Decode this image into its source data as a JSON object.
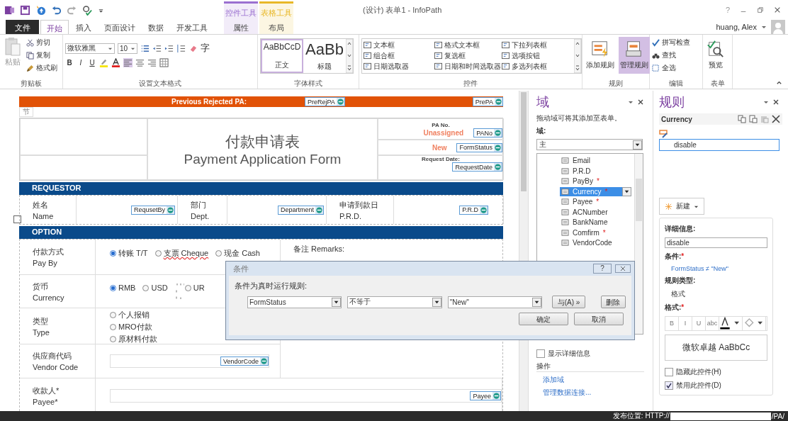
{
  "window": {
    "title": "(设计) 表单1 - InfoPath",
    "help": "?",
    "user": "huang, Alex"
  },
  "contextual_groups": [
    {
      "label": "控件工具",
      "color": "#9a6fd0"
    },
    {
      "label": "表格工具",
      "color": "#e8b828"
    }
  ],
  "tabs": [
    {
      "label": "文件",
      "kind": "file",
      "selected": false
    },
    {
      "label": "开始",
      "kind": "plain",
      "selected": true
    },
    {
      "label": "插入",
      "kind": "plain",
      "selected": false
    },
    {
      "label": "页面设计",
      "kind": "plain",
      "selected": false
    },
    {
      "label": "数据",
      "kind": "plain",
      "selected": false
    },
    {
      "label": "开发工具",
      "kind": "plain",
      "selected": false
    },
    {
      "label": "属性",
      "kind": "contextual",
      "selected": false
    },
    {
      "label": "布局",
      "kind": "contextual",
      "selected": false
    }
  ],
  "ribbon": {
    "clipboard": {
      "paste": "粘贴",
      "cut": "剪切",
      "copy": "复制",
      "painter": "格式刷",
      "label": "剪贴板"
    },
    "font": {
      "family": "微软雅黑",
      "size": "10",
      "bold": "B",
      "italic": "I",
      "underline": "U",
      "char": "字",
      "label": "设置文本格式",
      "align_buttons": [
        {
          "selected": true
        },
        {
          "selected": false
        },
        {
          "selected": false
        }
      ]
    },
    "styles": {
      "items": [
        {
          "sample": "AaBbCcD",
          "label": "正文",
          "selected": true
        },
        {
          "sample": "AaBb",
          "label": "标题",
          "selected": false
        }
      ],
      "label": "字体样式"
    },
    "controls": {
      "items": [
        "文本框",
        "格式文本框",
        "下拉列表框",
        "组合框",
        "复选框",
        "选项按钮",
        "日期选取器",
        "日期和时间选取器",
        "多选列表框"
      ],
      "label": "控件"
    },
    "rules": {
      "add": "添加规则",
      "manage": "管理规则",
      "manage_selected": true,
      "label": "规则"
    },
    "edit": {
      "spell": "拼写检查",
      "find": "查找",
      "select_all": "全选",
      "label": "编辑"
    },
    "form": {
      "preview": "预览",
      "label": "表单"
    }
  },
  "form": {
    "banner": {
      "label": "Previous Rejected PA:",
      "field_1": "PreRejPA",
      "field_2": "PrePA"
    },
    "section_tag": "节",
    "header": {
      "title_cn": "付款申请表",
      "title_en": "Payment Application Form",
      "pa_label": "PA No.",
      "pa_value": "Unassigned",
      "pa_field": "PANo",
      "status_value": "New",
      "status_field": "FormStatus",
      "date_label": "Request Date:",
      "date_field": "RequestDate"
    },
    "requestor": {
      "title": "REQUESTOR",
      "cells": [
        {
          "label_cn": "姓名",
          "label_en": "Name",
          "field": "RequsetBy"
        },
        {
          "label_cn": "部门",
          "label_en": "Dept.",
          "field": "Department"
        },
        {
          "label_cn": "申请到款日",
          "label_en": "P.R.D.",
          "field": "P.R.D"
        }
      ]
    },
    "option": {
      "title": "OPTION",
      "remarks": "备注 Remarks:",
      "rows": [
        {
          "label_cn": "付款方式",
          "label_en": "Pay By",
          "kind": "radio_row",
          "options": [
            {
              "label": "转账 T/T",
              "selected": true,
              "misspelled": false
            },
            {
              "label": "支票 Cheque",
              "selected": false,
              "misspelled": true
            },
            {
              "label": "现金 Cash",
              "selected": false,
              "misspelled": false
            }
          ]
        },
        {
          "label_cn": "货币",
          "label_en": "Currency",
          "kind": "radio_row",
          "options": [
            {
              "label": "RMB",
              "selected": true,
              "misspelled": false
            },
            {
              "label": "USD",
              "selected": false,
              "misspelled": false
            },
            {
              "label": "UR",
              "selected": false,
              "misspelled": false,
              "handle": true
            }
          ]
        },
        {
          "label_cn": "类型",
          "label_en": "Type",
          "kind": "radio_stack",
          "options": [
            {
              "label": "个人报销",
              "selected": false
            },
            {
              "label": "MRO付款",
              "selected": false
            },
            {
              "label": "原材料付款",
              "selected": false
            }
          ]
        },
        {
          "label_cn": "供应商代码",
          "label_en": "Vendor Code",
          "kind": "field",
          "field": "VendorCode"
        },
        {
          "label_cn": "收款人*",
          "label_en": "Payee*",
          "kind": "wide_field",
          "field": "Payee"
        }
      ]
    }
  },
  "fields_pane": {
    "title": "域",
    "hint": "拖动域可将其添加至表单。",
    "source_label": "域:",
    "source": "主",
    "items": [
      {
        "name": "Email",
        "selected": false
      },
      {
        "name": "P.R.D",
        "selected": false
      },
      {
        "name": "PayBy",
        "mark": "*",
        "selected": false
      },
      {
        "name": "Currency",
        "mark": "*",
        "selected": true
      },
      {
        "name": "Payee",
        "mark": "*",
        "selected": false
      },
      {
        "name": "ACNumber",
        "selected": false
      },
      {
        "name": "BankName",
        "selected": false
      },
      {
        "name": "Comfirm",
        "mark": "*",
        "selected": false
      },
      {
        "name": "VendorCode",
        "selected": false
      }
    ],
    "details": {
      "label": "显示详细信息",
      "checked": false
    },
    "actions_label": "操作",
    "links": [
      "添加域",
      "管理数据连接..."
    ]
  },
  "rules_pane": {
    "title": "规则",
    "control": "Currency",
    "rules": [
      {
        "name": "disable",
        "selected": true
      }
    ],
    "new": "新建",
    "details_label": "详细信息:",
    "details_value": "disable",
    "condition_label": "条件:",
    "condition_mark": "*",
    "condition": "FormStatus ≠ \"New\"",
    "type_label": "规则类型:",
    "type": "格式",
    "format_label": "格式:",
    "format_mark": "*",
    "format_buttons": [
      "B",
      "I",
      "U",
      "abc"
    ],
    "preview": "微软卓越  AaBbCc",
    "options": [
      {
        "label": "隐藏此控件(H)",
        "checked": false
      },
      {
        "label": "禁用此控件(D)",
        "checked": true
      }
    ]
  },
  "dialog": {
    "title": "条件",
    "help": "?",
    "prompt": "条件为真时运行规则:",
    "field": "FormStatus",
    "operator": "不等于",
    "value": "\"New\"",
    "and": "与(A) »",
    "delete": "删除",
    "ok": "确定",
    "cancel": "取消"
  },
  "status_bar": {
    "label": "发布位置: HTTP://",
    "suffix": "/PA/"
  }
}
